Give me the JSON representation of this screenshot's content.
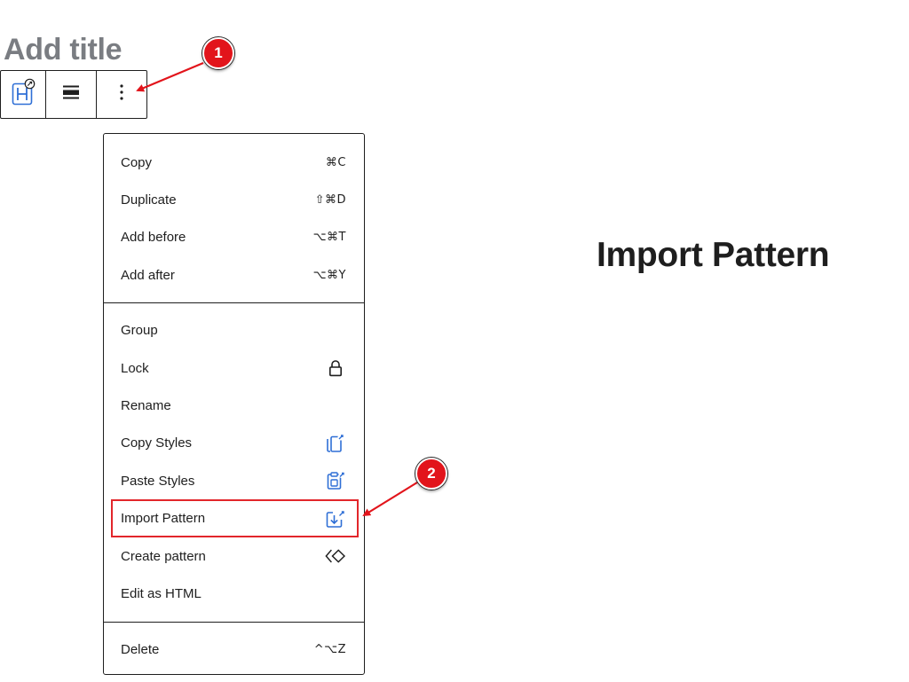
{
  "editor": {
    "title_placeholder": "Add title"
  },
  "toolbar": {
    "block_icon": "heading-block-icon",
    "align_icon": "justify-align-icon",
    "more_icon": "more-vertical-icon"
  },
  "menu": {
    "groups": [
      {
        "items": [
          {
            "label": "Copy",
            "shortcut": "⌘C"
          },
          {
            "label": "Duplicate",
            "shortcut": "⇧⌘D"
          },
          {
            "label": "Add before",
            "shortcut": "⌥⌘T"
          },
          {
            "label": "Add after",
            "shortcut": "⌥⌘Y"
          }
        ]
      },
      {
        "items": [
          {
            "label": "Group"
          },
          {
            "label": "Lock",
            "icon": "lock-icon"
          },
          {
            "label": "Rename"
          },
          {
            "label": "Copy Styles",
            "icon": "copy-styles-icon"
          },
          {
            "label": "Paste Styles",
            "icon": "paste-styles-icon"
          },
          {
            "label": "Import Pattern",
            "icon": "import-pattern-icon"
          },
          {
            "label": "Create pattern",
            "icon": "create-pattern-icon"
          },
          {
            "label": "Edit as HTML"
          }
        ]
      },
      {
        "items": [
          {
            "label": "Delete",
            "shortcut": "^⌥Z"
          }
        ]
      }
    ]
  },
  "annotation": {
    "heading": "Import Pattern",
    "badge_1": "1",
    "badge_2": "2"
  },
  "colors": {
    "annotation_red": "#e2141b",
    "brand_icon_blue": "#2f6fd6",
    "text": "#1e1e1e",
    "placeholder_gray": "#7a7d82"
  }
}
